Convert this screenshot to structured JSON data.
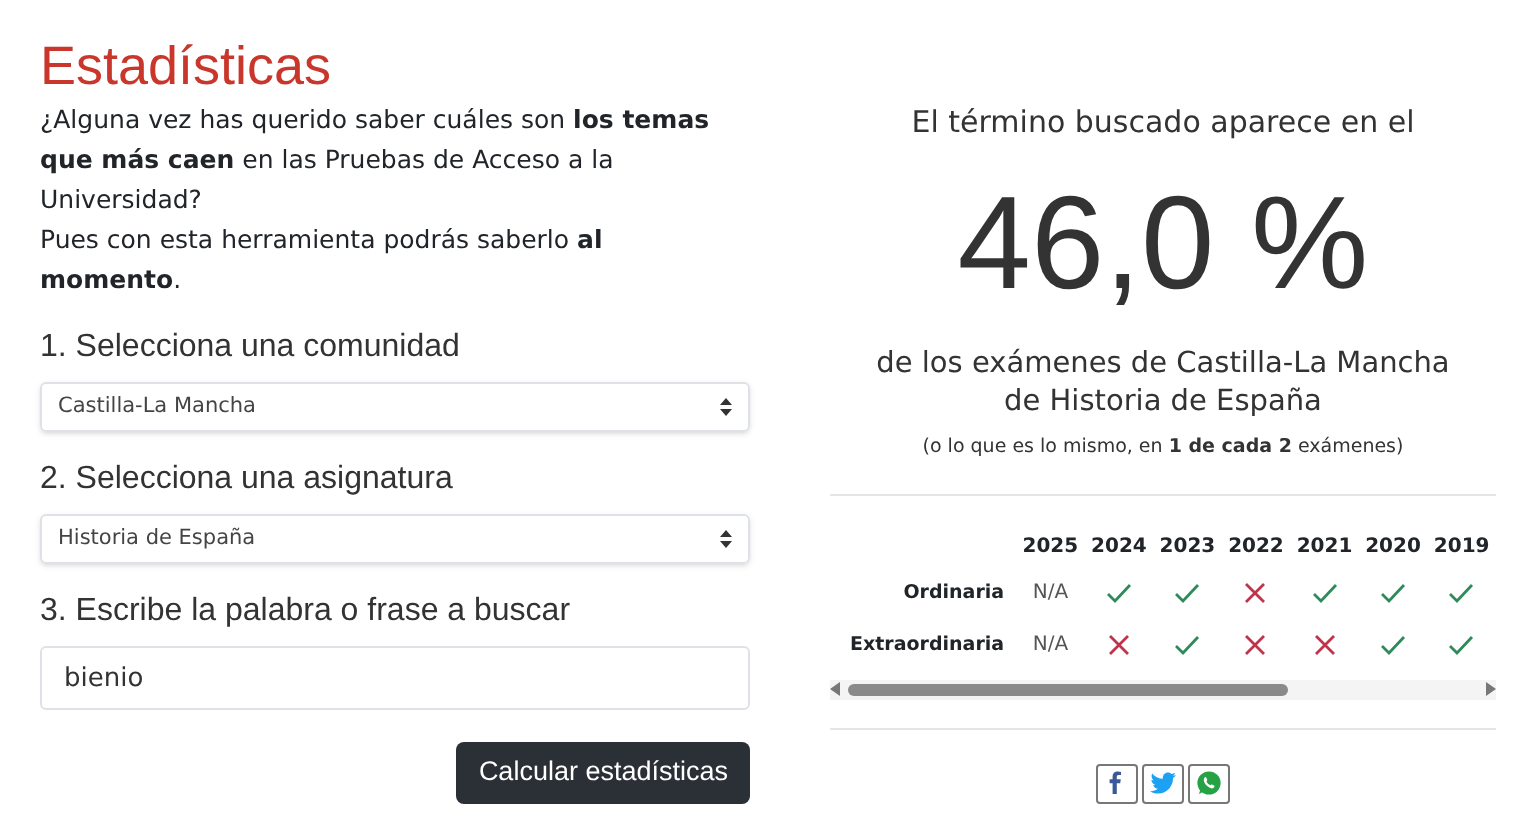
{
  "title": "Estadísticas",
  "intro": [
    "¿Alguna vez has querido saber cuáles son **los temas que más caen** en las Pruebas de Acceso a la Universidad?",
    "Pues con esta herramienta podrás saberlo **al momento**."
  ],
  "steps": [
    {
      "kind": "select",
      "label": "1. Selecciona una comunidad",
      "value": "Castilla-La Mancha"
    },
    {
      "kind": "select",
      "label": "2. Selecciona una asignatura",
      "value": "Historia de España"
    },
    {
      "kind": "input",
      "label": "3. Escribe la palabra o frase a buscar",
      "value": "bienio"
    }
  ],
  "submit_button": "Calcular estadísticas",
  "result": {
    "lead": "El término buscado aparece en el",
    "percentage": "46,0 %",
    "lines": [
      "de los exámenes de Castilla-La Mancha",
      "de Historia de España"
    ],
    "note": "(o lo que es lo mismo, en **1 de cada 2** exámenes)"
  },
  "table": {
    "columns": [
      "2025",
      "2024",
      "2023",
      "2022",
      "2021",
      "2020",
      "2019"
    ],
    "rows": [
      {
        "label": "Ordinaria",
        "cells": [
          {
            "kind": "text",
            "text": "N/A"
          },
          {
            "kind": "yes"
          },
          {
            "kind": "yes"
          },
          {
            "kind": "no"
          },
          {
            "kind": "yes"
          },
          {
            "kind": "yes"
          },
          {
            "kind": "yes"
          }
        ]
      },
      {
        "label": "Extraordinaria",
        "cells": [
          {
            "kind": "text",
            "text": "N/A"
          },
          {
            "kind": "no"
          },
          {
            "kind": "yes"
          },
          {
            "kind": "no"
          },
          {
            "kind": "no"
          },
          {
            "kind": "yes"
          },
          {
            "kind": "yes"
          }
        ]
      }
    ]
  },
  "share": [
    {
      "kind": "facebook"
    },
    {
      "kind": "twitter"
    },
    {
      "kind": "whatsapp"
    }
  ]
}
